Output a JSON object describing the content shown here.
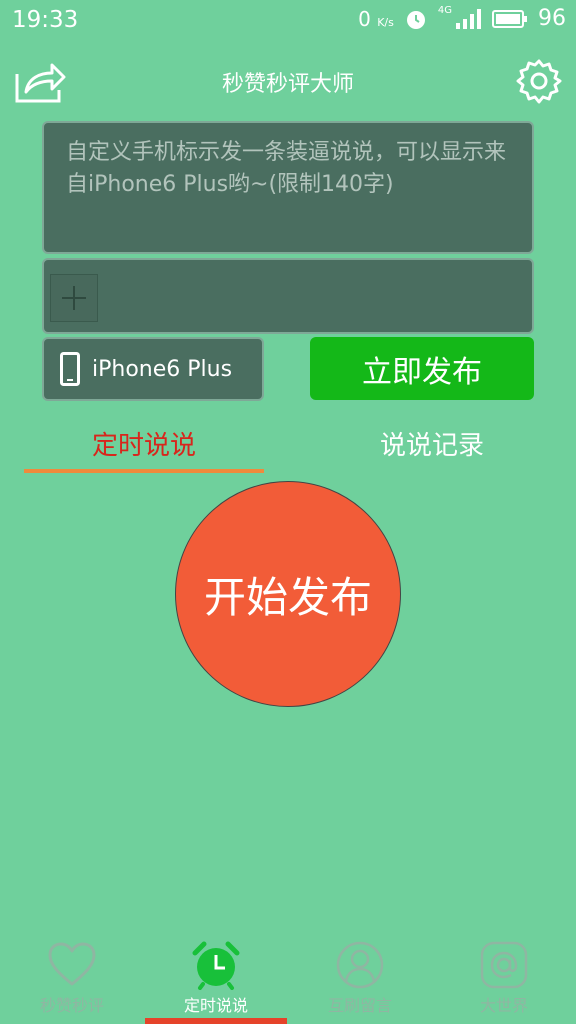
{
  "status_bar": {
    "time": "19:33",
    "net_speed": "0",
    "net_speed_unit": "K/s",
    "network": "4G",
    "battery": "96"
  },
  "header": {
    "title": "秒赞秒评大师"
  },
  "composer": {
    "placeholder": "自定义手机标示发一条装逼说说，可以显示来自iPhone6 Plus哟~(限制140字)",
    "value": ""
  },
  "device": {
    "label": "iPhone6 Plus"
  },
  "publish": {
    "label": "立即发布"
  },
  "tabs": [
    {
      "label": "定时说说"
    },
    {
      "label": "说说记录"
    }
  ],
  "start": {
    "label": "开始发布"
  },
  "bottom_nav": [
    {
      "label": "秒赞秒评",
      "icon": "heart-icon"
    },
    {
      "label": "定时说说",
      "icon": "alarm-clock-icon"
    },
    {
      "label": "互刷留言",
      "icon": "person-icon"
    },
    {
      "label": "大世界",
      "icon": "at-icon"
    }
  ],
  "colors": {
    "background": "#6fd09c",
    "panel": "#4a6e60",
    "publish_button": "#14b818",
    "start_button": "#f25c38",
    "active_tab_text": "#d8261c",
    "tab_indicator": "#f08a3c",
    "nav_active_bar": "#e5432a"
  }
}
